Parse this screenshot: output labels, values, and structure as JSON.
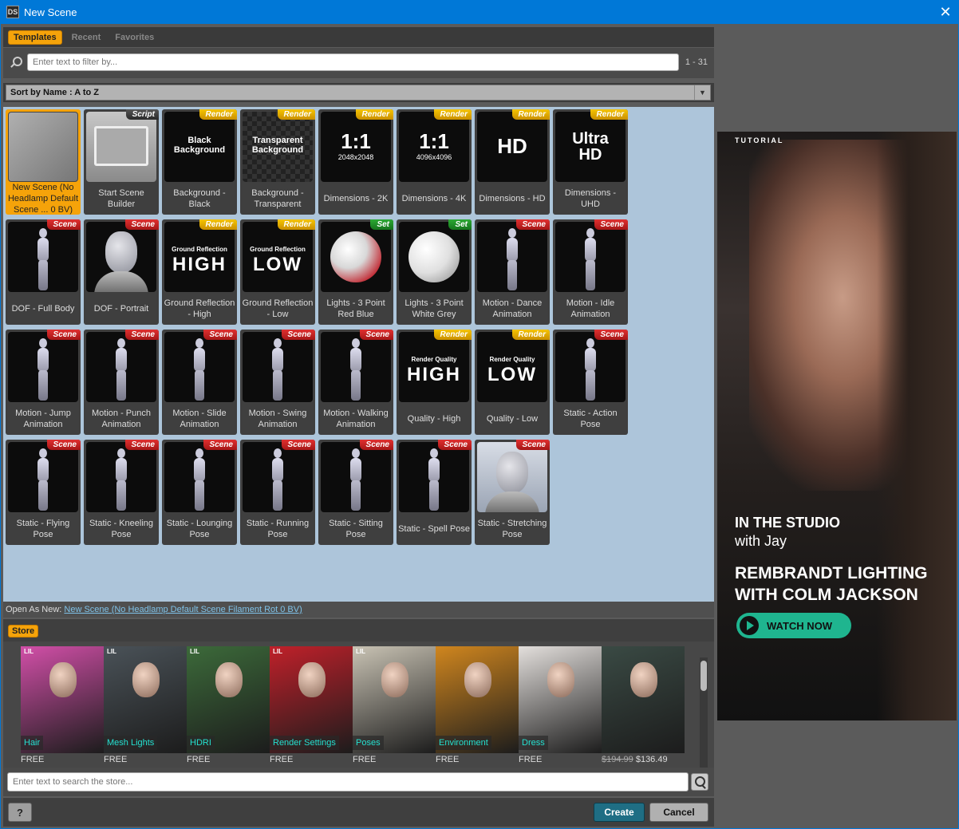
{
  "window": {
    "title": "New Scene",
    "icon_text": "DS",
    "close_glyph": "✕"
  },
  "tabs": [
    {
      "label": "Templates",
      "active": true
    },
    {
      "label": "Recent",
      "active": false
    },
    {
      "label": "Favorites",
      "active": false
    }
  ],
  "filter": {
    "placeholder": "Enter text to filter by...",
    "count": "1 - 31"
  },
  "sort": {
    "label": "Sort by Name : A to Z"
  },
  "tiles": [
    {
      "label": "New Scene (No Headlamp Default Scene ... 0 BV)",
      "badge": "",
      "art": "selected",
      "big": "",
      "sub": ""
    },
    {
      "label": "Start Scene Builder",
      "badge": "Script",
      "art": "script",
      "big": "",
      "sub": ""
    },
    {
      "label": "Background - Black",
      "badge": "Render",
      "art": "text",
      "big": "Black Background",
      "sub": ""
    },
    {
      "label": "Background - Transparent",
      "badge": "Render",
      "art": "checker",
      "big": "Transparent Background",
      "sub": ""
    },
    {
      "label": "Dimensions - 2K",
      "badge": "Render",
      "art": "ratio",
      "big": "1:1",
      "sub": "2048x2048"
    },
    {
      "label": "Dimensions - 4K",
      "badge": "Render",
      "art": "ratio",
      "big": "1:1",
      "sub": "4096x4096"
    },
    {
      "label": "Dimensions - HD",
      "badge": "Render",
      "art": "hd",
      "big": "HD",
      "sub": ""
    },
    {
      "label": "Dimensions - UHD",
      "badge": "Render",
      "art": "uhd",
      "big": "Ultra HD",
      "sub": ""
    },
    {
      "label": "DOF - Full Body",
      "badge": "Scene",
      "art": "figure",
      "big": "",
      "sub": ""
    },
    {
      "label": "DOF - Portrait",
      "badge": "Scene",
      "art": "portrait",
      "big": "",
      "sub": ""
    },
    {
      "label": "Ground Reflection - High",
      "badge": "Render",
      "art": "reflect",
      "big": "HIGH",
      "sub": "Ground Reflection"
    },
    {
      "label": "Ground Reflection - Low",
      "badge": "Render",
      "art": "reflect",
      "big": "LOW",
      "sub": "Ground Reflection"
    },
    {
      "label": "Lights - 3 Point Red Blue",
      "badge": "Set",
      "art": "sphere-red",
      "big": "",
      "sub": ""
    },
    {
      "label": "Lights - 3 Point White Grey",
      "badge": "Set",
      "art": "sphere-white",
      "big": "",
      "sub": ""
    },
    {
      "label": "Motion - Dance Animation",
      "badge": "Scene",
      "art": "figure",
      "big": "",
      "sub": ""
    },
    {
      "label": "Motion - Idle Animation",
      "badge": "Scene",
      "art": "figure",
      "big": "",
      "sub": ""
    },
    {
      "label": "Motion - Jump Animation",
      "badge": "Scene",
      "art": "figure",
      "big": "",
      "sub": ""
    },
    {
      "label": "Motion - Punch Animation",
      "badge": "Scene",
      "art": "figure",
      "big": "",
      "sub": ""
    },
    {
      "label": "Motion - Slide Animation",
      "badge": "Scene",
      "art": "figure",
      "big": "",
      "sub": ""
    },
    {
      "label": "Motion - Swing Animation",
      "badge": "Scene",
      "art": "figure",
      "big": "",
      "sub": ""
    },
    {
      "label": "Motion - Walking Animation",
      "badge": "Scene",
      "art": "figure",
      "big": "",
      "sub": ""
    },
    {
      "label": "Quality - High",
      "badge": "Render",
      "art": "quality",
      "big": "HIGH",
      "sub": "Render Quality"
    },
    {
      "label": "Quality - Low",
      "badge": "Render",
      "art": "quality",
      "big": "LOW",
      "sub": "Render Quality"
    },
    {
      "label": "Static - Action Pose",
      "badge": "Scene",
      "art": "figure",
      "big": "",
      "sub": ""
    },
    {
      "label": "Static - Flying Pose",
      "badge": "Scene",
      "art": "figure",
      "big": "",
      "sub": ""
    },
    {
      "label": "Static - Kneeling Pose",
      "badge": "Scene",
      "art": "figure",
      "big": "",
      "sub": ""
    },
    {
      "label": "Static - Lounging Pose",
      "badge": "Scene",
      "art": "figure",
      "big": "",
      "sub": ""
    },
    {
      "label": "Static - Running Pose",
      "badge": "Scene",
      "art": "figure",
      "big": "",
      "sub": ""
    },
    {
      "label": "Static - Sitting Pose",
      "badge": "Scene",
      "art": "figure",
      "big": "",
      "sub": ""
    },
    {
      "label": "Static - Spell Pose",
      "badge": "Scene",
      "art": "figure",
      "big": "",
      "sub": ""
    },
    {
      "label": "Static - Stretching Pose",
      "badge": "Scene",
      "art": "portrait-light",
      "big": "",
      "sub": ""
    }
  ],
  "open_as": {
    "prefix": "Open As New:",
    "link": "New Scene (No Headlamp Default Scene Filament Rot 0 BV)"
  },
  "store": {
    "tab": "Store",
    "search_placeholder": "Enter text to search the store...",
    "products": [
      {
        "category": "Hair",
        "price": "FREE",
        "old_price": "",
        "lil": "LIL",
        "color": "#d24fa8"
      },
      {
        "category": "Mesh Lights",
        "price": "FREE",
        "old_price": "",
        "lil": "LIL",
        "color": "#4a5258"
      },
      {
        "category": "HDRI",
        "price": "FREE",
        "old_price": "",
        "lil": "LIL",
        "color": "#3c6a3a"
      },
      {
        "category": "Render Settings",
        "price": "FREE",
        "old_price": "",
        "lil": "LIL",
        "color": "#c0202a"
      },
      {
        "category": "Poses",
        "price": "FREE",
        "old_price": "",
        "lil": "LIL",
        "color": "#c9c3b4"
      },
      {
        "category": "Environment",
        "price": "FREE",
        "old_price": "",
        "lil": "",
        "color": "#d0861e"
      },
      {
        "category": "Dress",
        "price": "FREE",
        "old_price": "",
        "lil": "",
        "color": "#e3dfdc"
      },
      {
        "category": "",
        "price": "$136.49",
        "old_price": "$194.99",
        "lil": "",
        "color": "#3a4a44"
      }
    ]
  },
  "buttons": {
    "help": "?",
    "create": "Create",
    "cancel": "Cancel"
  },
  "ad": {
    "kicker": "TUTORIAL",
    "line1": "IN THE STUDIO",
    "line2": "with Jay",
    "headline": "REMBRANDT LIGHTING WITH COLM JACKSON",
    "cta": "WATCH NOW"
  }
}
